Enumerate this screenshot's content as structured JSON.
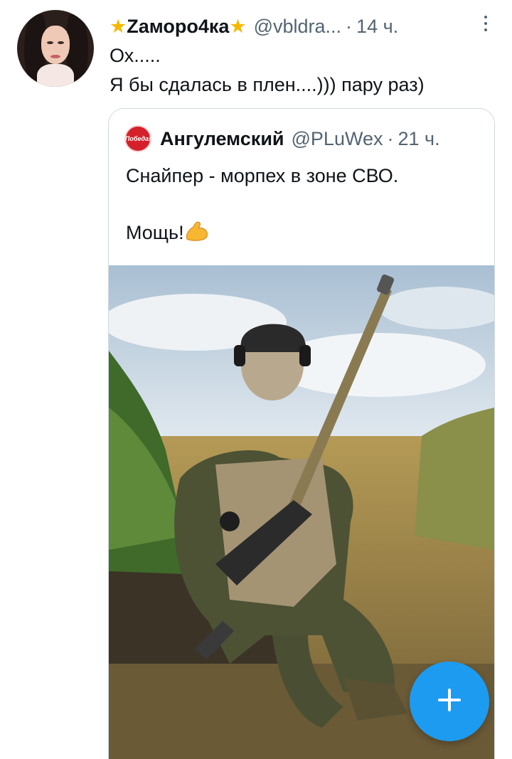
{
  "tweet": {
    "author": {
      "name": "Zаморо4ка",
      "handle": "@vbldra...",
      "time": "14 ч.",
      "avatar_icon": "user-avatar-photo"
    },
    "separator": "·",
    "lines": [
      "Ох.....",
      "Я бы сдалась в плен....))) пару раз)"
    ],
    "star_icon": "★"
  },
  "quote": {
    "author": {
      "name": "Ангулемский",
      "handle": "@PLuWex",
      "time": "21 ч.",
      "avatar_text": "Победа!"
    },
    "separator": "·",
    "text": "Снайпер - морпех в зоне СВО.\n\nМощь!",
    "emoji_icon": "flexed-biceps-icon",
    "media_icon": "sniper-soldier-photo"
  },
  "fab": {
    "icon": "plus-icon",
    "color": "#1d9bf0"
  },
  "colors": {
    "text": "#0f1419",
    "muted": "#536471",
    "border": "#cfd9de",
    "star": "#f5b800"
  }
}
